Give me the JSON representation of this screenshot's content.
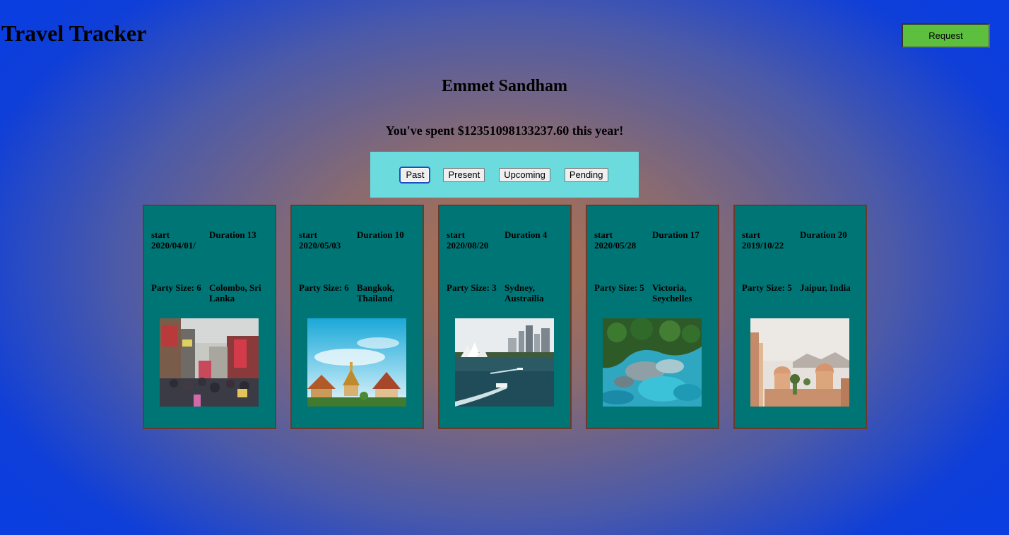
{
  "header": {
    "title": "Travel Tracker",
    "request_label": "Request"
  },
  "user": {
    "name": "Emmet Sandham",
    "spent_text": "You've spent $12351098133237.60 this year!"
  },
  "filters": [
    {
      "label": "Past",
      "active": true
    },
    {
      "label": "Present",
      "active": false
    },
    {
      "label": "Upcoming",
      "active": false
    },
    {
      "label": "Pending",
      "active": false
    }
  ],
  "colors": {
    "card_bg": "#007575",
    "card_border": "#6b3a2a",
    "filter_bar_bg": "#6bdbde",
    "request_bg": "#5cbf3e"
  },
  "trips": [
    {
      "start": "start 2020/04/01/",
      "duration": "Duration 13",
      "party": "Party Size: 6",
      "destination": "Colombo, Sri Lanka",
      "image": "colombo-street-photo"
    },
    {
      "start": "start 2020/05/03",
      "duration": "Duration 10",
      "party": "Party Size: 6",
      "destination": "Bangkok, Thailand",
      "image": "bangkok-temple-photo"
    },
    {
      "start": "start 2020/08/20",
      "duration": "Duration 4",
      "party": "Party Size: 3",
      "destination": "Sydney, Austrailia",
      "image": "sydney-harbour-photo"
    },
    {
      "start": "start 2020/05/28",
      "duration": "Duration 17",
      "party": "Party Size: 5",
      "destination": "Victoria, Seychelles",
      "image": "seychelles-coast-photo"
    },
    {
      "start": "start 2019/10/22",
      "duration": "Duration 20",
      "party": "Party Size: 5",
      "destination": "Jaipur, India",
      "image": "jaipur-palace-photo"
    }
  ]
}
